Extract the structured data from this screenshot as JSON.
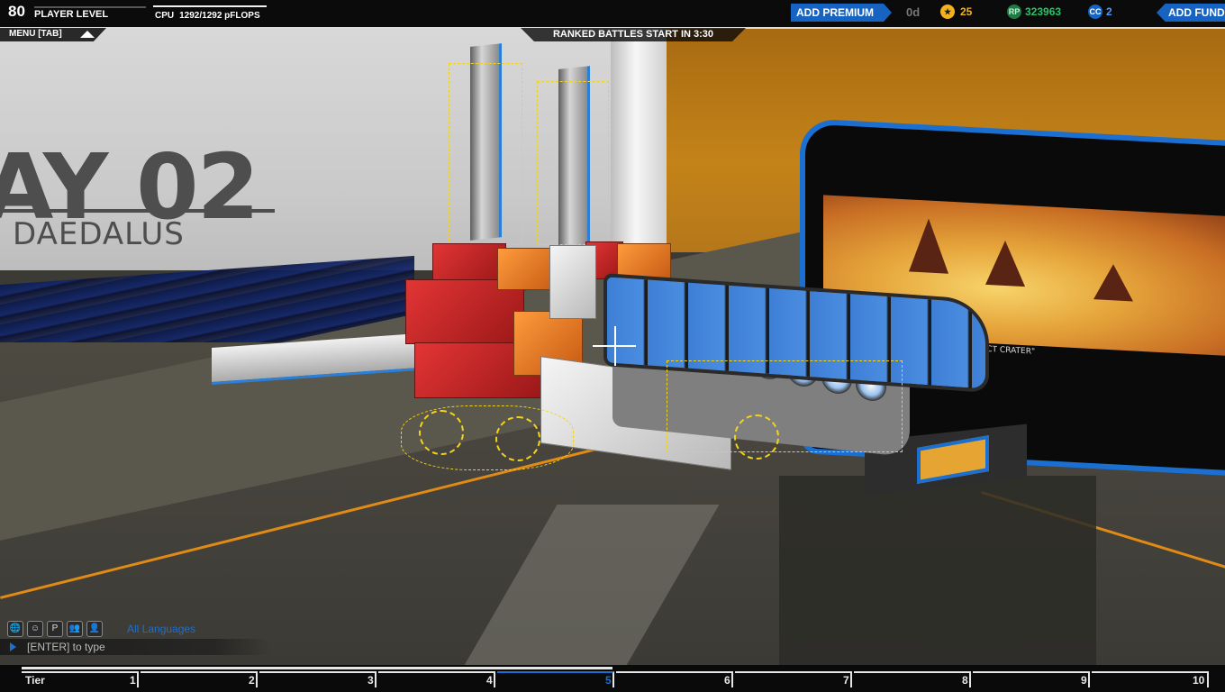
{
  "hud": {
    "player_level": "80",
    "player_level_label": "PLAYER LEVEL",
    "level_progress": 0.0,
    "cpu_label": "CPU",
    "cpu_value": "1292/1292 pFLOPS",
    "cpu_fraction": 1.0,
    "menu_label": "MENU [TAB]",
    "ranked_label": "RANKED BATTLES START IN 3:30",
    "premium_button": "ADD PREMIUM",
    "premium_days": "0d",
    "stars": "25",
    "robits": "323963",
    "cosmetic_credits": "2",
    "funds_button": "ADD FUNDS",
    "colors": {
      "accent": "#1663c2",
      "robits": "#29c46a",
      "stars": "#f2b21b"
    }
  },
  "scene": {
    "bay_number": "AY 02",
    "bay_name": "DAEDALUS",
    "screen_caption": "IMPACT CRATER\""
  },
  "chat": {
    "icons": [
      "globe-icon",
      "accessibility-icon",
      "party-icon",
      "friend-icon",
      "clan-icon"
    ],
    "icon_glyphs": [
      "🌐",
      "☺",
      "P",
      "👥",
      "👤"
    ],
    "language": "All Languages",
    "placeholder": "[ENTER] to type"
  },
  "tier": {
    "label": "Tier",
    "numbers": [
      "1",
      "2",
      "3",
      "4",
      "5",
      "6",
      "7",
      "8",
      "9",
      "10"
    ],
    "current": "5"
  }
}
